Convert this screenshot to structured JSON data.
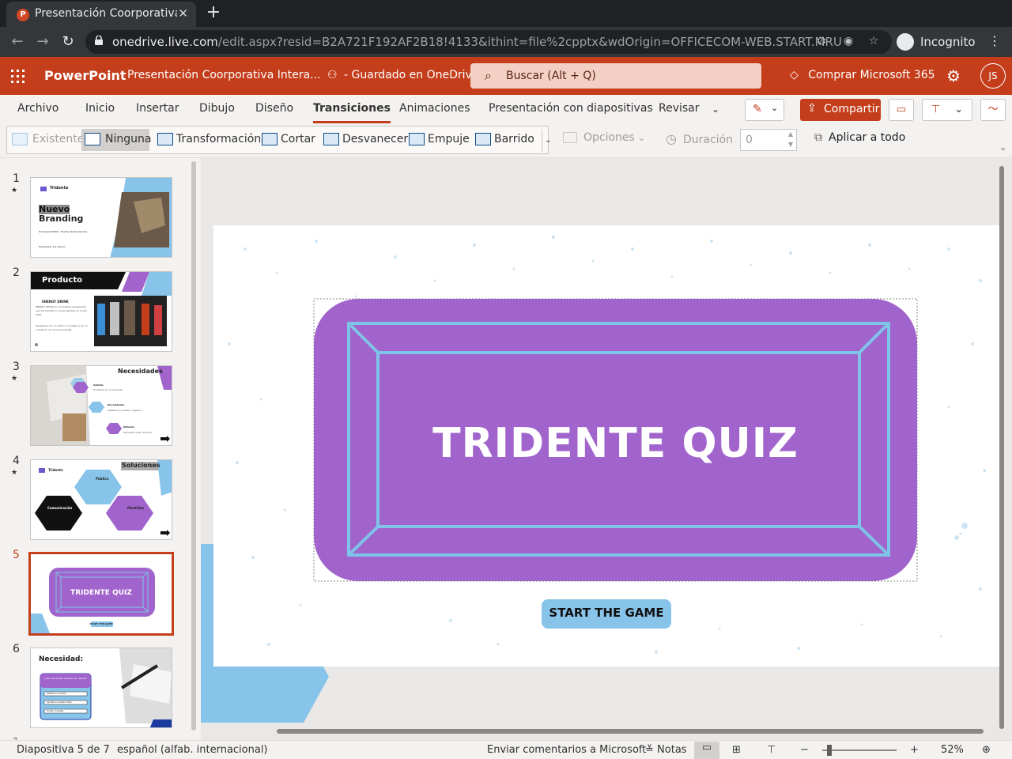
{
  "browser": {
    "tab_title": "Presentación Coorporativa Interactiva",
    "tab_favicon": "P",
    "url_host": "onedrive.live.com",
    "url_path": "/edit.aspx?resid=B2A721F192AF2B18!4133&ithint=file%2cpptx&wdOrigin=OFFICECOM-WEB.START.MRU",
    "incognito_label": "Incognito"
  },
  "office": {
    "app_name": "PowerPoint",
    "doc_name": "Presentación Coorporativa Intera...",
    "save_status": "Guardado en OneDrive",
    "search_placeholder": "Buscar (Alt + Q)",
    "buy_label": "Comprar Microsoft 365",
    "user_initials": "JS",
    "accent": "#c43e1c"
  },
  "ribbon_tabs": [
    "Archivo",
    "Inicio",
    "Insertar",
    "Dibujo",
    "Diseño",
    "Transiciones",
    "Animaciones",
    "Presentación con diapositivas",
    "Revisar"
  ],
  "active_tab": "Transiciones",
  "share_label": "Compartir",
  "transitions": [
    "Existente",
    "Ninguna",
    "Transformación",
    "Cortar",
    "Desvanecer",
    "Empuje",
    "Barrido"
  ],
  "selected_transition": "Ninguna",
  "options_label": "Opciones",
  "duration_label": "Duración",
  "duration_value": "0",
  "apply_all_label": "Aplicar a todo",
  "slides": [
    {
      "num": "1",
      "star": "★",
      "title": "Nuevo",
      "title2": "Branding",
      "brand": "Tridente",
      "subtitle": "Empresa B'S006 · Cliente Ventas Service",
      "footer": "Presentado por Jazmin"
    },
    {
      "num": "2",
      "title": "Producto",
      "heading": "ENERGY DRINK",
      "text": "ENERGY DRINK es una bebida energizante que fue lanzada y comercializada en el año 2001.",
      "text2": "Destacado por un público completo y de un contenido con plus de energía."
    },
    {
      "num": "3",
      "star": "★",
      "title": "Necesidades",
      "items": [
        {
          "h": "Anklets",
          "t": "Envidioso en al mercado."
        },
        {
          "h": "Necesidades",
          "t": "Satisface su público objetivo."
        },
        {
          "h": "Difusión",
          "t": "Generate mejor alcance."
        }
      ]
    },
    {
      "num": "4",
      "star": "★",
      "title": "Soluciones",
      "brand": "Tridente",
      "h1": "Público",
      "h2": "Comunicación",
      "h3": "Plantillas"
    },
    {
      "num": "5",
      "title": "TRIDENTE QUIZ",
      "button": "START THE GAME"
    },
    {
      "num": "6",
      "title": "Necesidad:",
      "question": "¿Qué necesidad requiere el cliente?",
      "options": [
        "Diseñar en correcto",
        "Aportar a su público final",
        "Es Plan completo"
      ]
    }
  ],
  "active_slide_index": 4,
  "main_slide": {
    "title": "TRIDENTE QUIZ",
    "button": "START THE GAME",
    "purple": "#a064cc",
    "line_color": "#7fc4e8",
    "shape_blue": "#88c4ea"
  },
  "statusbar": {
    "slide_of": "Diapositiva 5 de 7",
    "language": "español (alfab. internacional)",
    "feedback": "Enviar comentarios a Microsoft",
    "notes": "Notas",
    "zoom": "52%"
  }
}
